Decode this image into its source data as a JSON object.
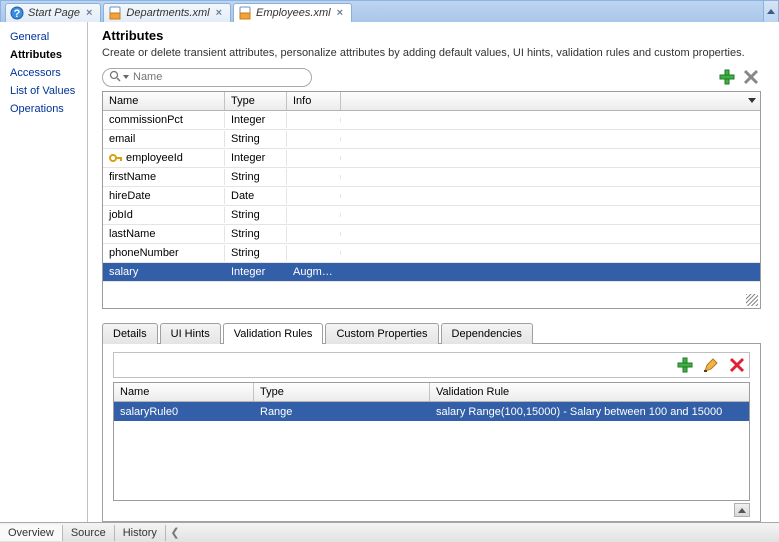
{
  "tabs": [
    {
      "label": "Start Page",
      "icon": "info-circle"
    },
    {
      "label": "Departments.xml",
      "icon": "xml-doc"
    },
    {
      "label": "Employees.xml",
      "icon": "xml-doc",
      "active": true
    }
  ],
  "sidebar": {
    "items": [
      {
        "label": "General"
      },
      {
        "label": "Attributes",
        "selected": true
      },
      {
        "label": "Accessors"
      },
      {
        "label": "List of Values"
      },
      {
        "label": "Operations"
      }
    ]
  },
  "main": {
    "title": "Attributes",
    "description": "Create or delete transient attributes, personalize attributes by adding default values, UI hints, validation rules and custom properties."
  },
  "search": {
    "placeholder": "Name"
  },
  "attr_grid": {
    "columns": {
      "name": "Name",
      "type": "Type",
      "info": "Info"
    },
    "rows": [
      {
        "name": "commissionPct",
        "type": "Integer",
        "info": "",
        "key": false
      },
      {
        "name": "email",
        "type": "String",
        "info": "",
        "key": false
      },
      {
        "name": "employeeId",
        "type": "Integer",
        "info": "",
        "key": true
      },
      {
        "name": "firstName",
        "type": "String",
        "info": "",
        "key": false
      },
      {
        "name": "hireDate",
        "type": "Date",
        "info": "",
        "key": false
      },
      {
        "name": "jobId",
        "type": "String",
        "info": "",
        "key": false
      },
      {
        "name": "lastName",
        "type": "String",
        "info": "",
        "key": false
      },
      {
        "name": "phoneNumber",
        "type": "String",
        "info": "",
        "key": false
      },
      {
        "name": "salary",
        "type": "Integer",
        "info": "Augmen...",
        "selected": true
      }
    ]
  },
  "subtabs": [
    {
      "label": "Details"
    },
    {
      "label": "UI Hints"
    },
    {
      "label": "Validation Rules",
      "active": true
    },
    {
      "label": "Custom Properties"
    },
    {
      "label": "Dependencies"
    }
  ],
  "rules_grid": {
    "columns": {
      "name": "Name",
      "type": "Type",
      "rule": "Validation Rule"
    },
    "rows": [
      {
        "name": "salaryRule0",
        "type": "Range",
        "rule": "salary Range(100,15000) - Salary between 100 and 15000",
        "selected": true
      }
    ]
  },
  "bottom_tabs": [
    {
      "label": "Overview",
      "active": true
    },
    {
      "label": "Source"
    },
    {
      "label": "History"
    }
  ],
  "icons": {
    "add": "add-icon",
    "delete": "delete-icon",
    "edit": "edit-icon",
    "key": "key-icon"
  }
}
